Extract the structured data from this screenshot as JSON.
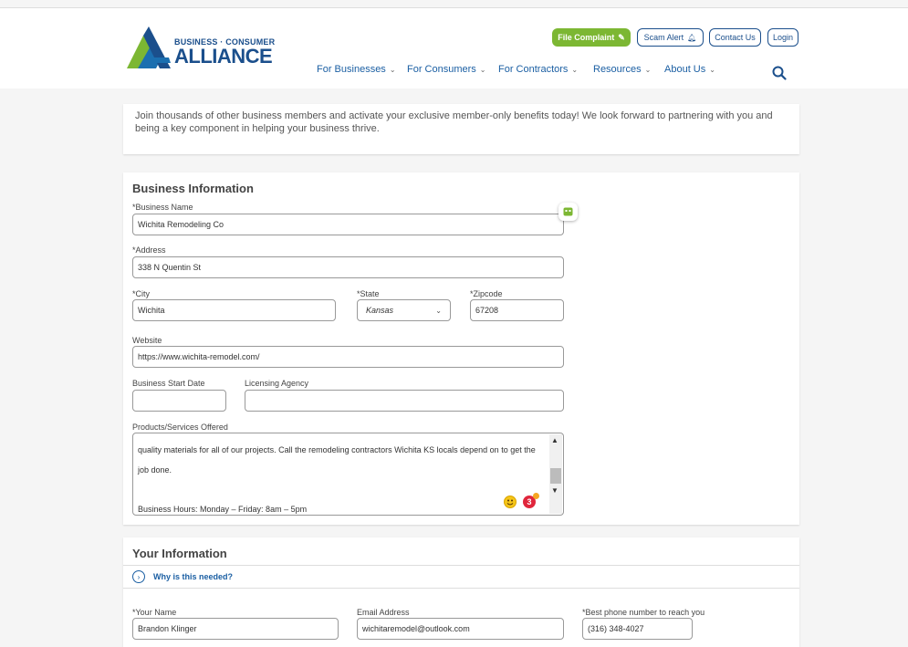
{
  "header": {
    "logo_line1": "BUSINESS · CONSUMER",
    "logo_line2": "ALLIANCE",
    "buttons": {
      "file_complaint": "File Complaint",
      "scam_alert": "Scam Alert",
      "contact_us": "Contact Us",
      "login": "Login"
    },
    "nav": [
      {
        "label": "For Businesses"
      },
      {
        "label": "For Consumers"
      },
      {
        "label": "For Contractors"
      },
      {
        "label": "Resources"
      },
      {
        "label": "About Us"
      }
    ]
  },
  "intro": {
    "text": "Join thousands of other business members and activate your exclusive member-only benefits today! We look forward to partnering with you and being a key component in helping your business thrive."
  },
  "business": {
    "title": "Business Information",
    "name_label": "*Business Name",
    "name_value": "Wichita Remodeling Co",
    "address_label": "*Address",
    "address_value": "338 N Quentin St",
    "city_label": "*City",
    "city_value": "Wichita",
    "state_label": "*State",
    "state_value": "Kansas",
    "zip_label": "*Zipcode",
    "zip_value": "67208",
    "website_label": "Website",
    "website_value": "https://www.wichita-remodel.com/",
    "start_label": "Business Start Date",
    "start_value": "",
    "agency_label": "Licensing Agency",
    "agency_value": "",
    "services_label": "Products/Services Offered",
    "services_lines": [
      "quality materials for all of our projects. Call the remodeling contractors Wichita KS locals depend on to get the",
      "job done.",
      "",
      "Business Hours: Monday – Friday: 8am – 5pm"
    ],
    "emoji_count": "3"
  },
  "your_info": {
    "title": "Your Information",
    "why_label": "Why is this needed?",
    "name_label": "*Your Name",
    "name_value": "Brandon Klinger",
    "email_label": "Email Address",
    "email_value": "wichitaremodel@outlook.com",
    "phone_label": "*Best phone number to reach you",
    "phone_value": "(316) 348-4027"
  },
  "colors": {
    "brand_blue": "#1b4f8c",
    "link_blue": "#1b5fa3",
    "brand_green": "#7cb733"
  }
}
